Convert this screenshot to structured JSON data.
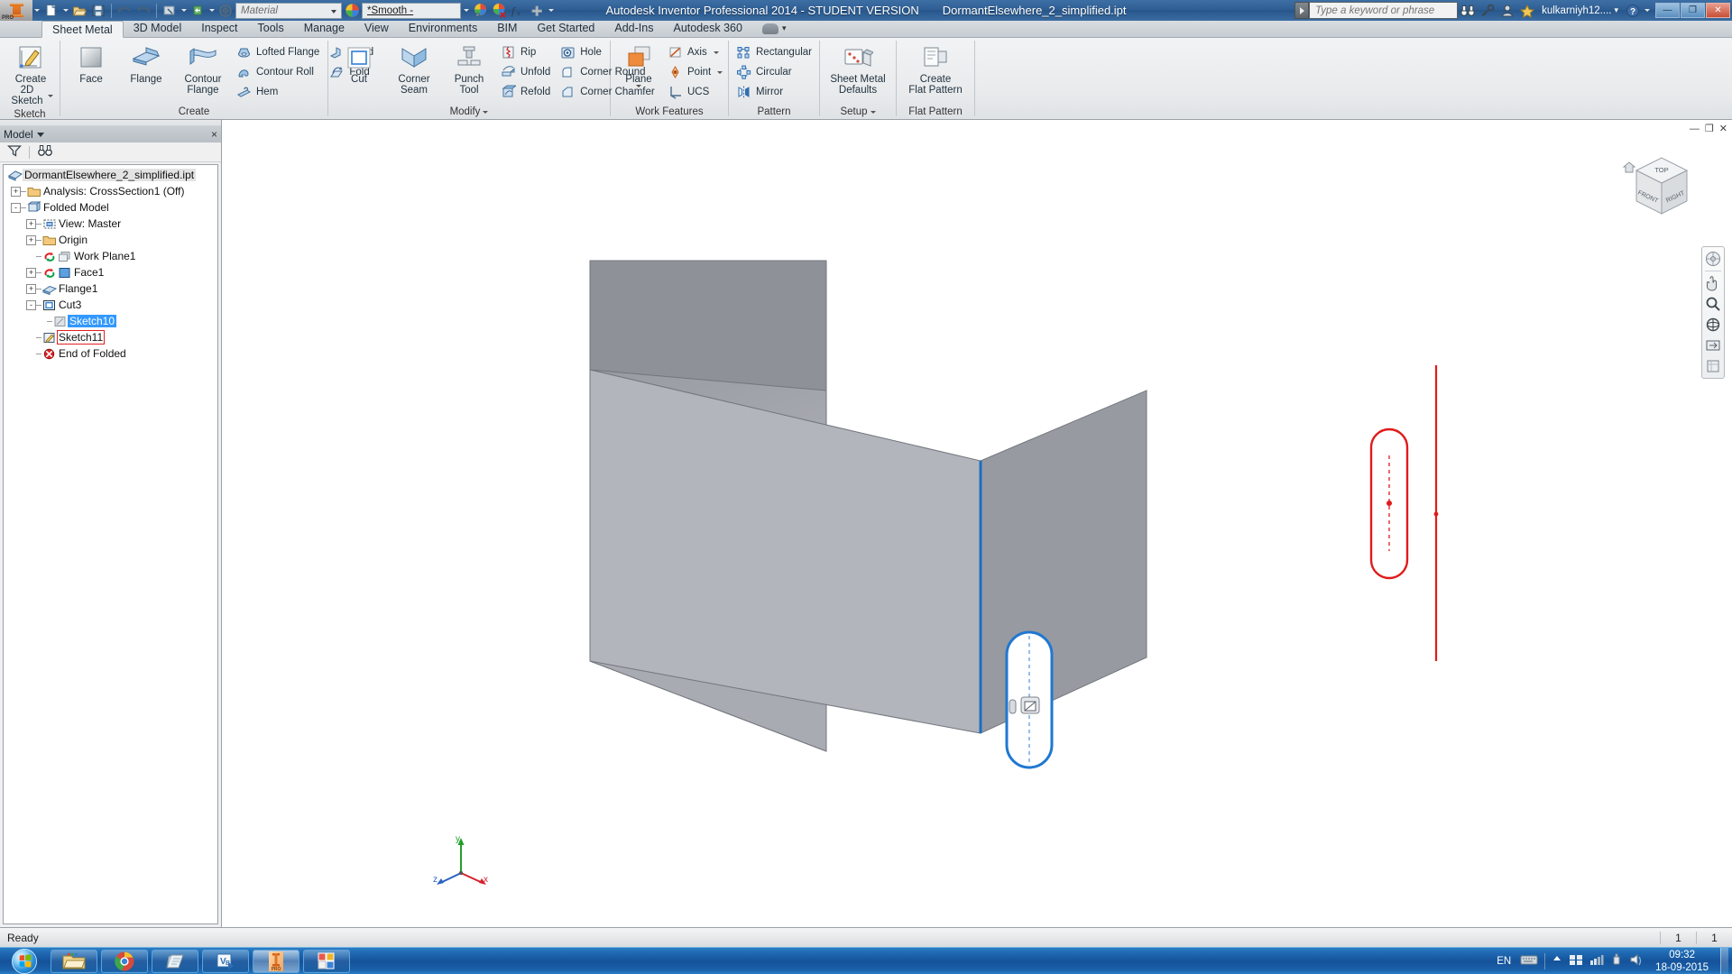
{
  "window": {
    "title": "Autodesk Inventor Professional 2014 - STUDENT VERSION",
    "filename": "DormantElsewhere_2_simplified.ipt",
    "minimize_label": "—",
    "maximize_label": "❐",
    "close_label": "✕"
  },
  "quick_access": {
    "material_value": "Material",
    "appearance_value": "*Smooth -",
    "buttons": [
      {
        "name": "new-document",
        "tip": "New"
      },
      {
        "name": "open-document",
        "tip": "Open"
      },
      {
        "name": "save-document",
        "tip": "Save"
      },
      {
        "name": "undo",
        "tip": "Undo"
      },
      {
        "name": "redo",
        "tip": "Redo"
      },
      {
        "name": "select",
        "tip": "Select"
      },
      {
        "name": "return",
        "tip": "Return"
      },
      {
        "name": "update",
        "tip": "Update"
      },
      {
        "name": "appearance",
        "tip": "Appearance"
      },
      {
        "name": "clear-appearance",
        "tip": "Clear Appearance"
      },
      {
        "name": "parameters",
        "tip": "fx Parameters"
      },
      {
        "name": "customize",
        "tip": "Customize"
      }
    ]
  },
  "infocenter": {
    "search_placeholder": "Type a keyword or phrase",
    "user": "kulkarniyh12....",
    "icons": [
      "binoculars-icon",
      "key-icon",
      "person-icon",
      "star-icon",
      "sign-in-icon",
      "help-icon"
    ]
  },
  "tabs": [
    {
      "label": "Sheet Metal",
      "active": true
    },
    {
      "label": "3D Model",
      "active": false
    },
    {
      "label": "Inspect",
      "active": false
    },
    {
      "label": "Tools",
      "active": false
    },
    {
      "label": "Manage",
      "active": false
    },
    {
      "label": "View",
      "active": false
    },
    {
      "label": "Environments",
      "active": false
    },
    {
      "label": "BIM",
      "active": false
    },
    {
      "label": "Get Started",
      "active": false
    },
    {
      "label": "Add-Ins",
      "active": false
    },
    {
      "label": "Autodesk 360",
      "active": false
    }
  ],
  "ribbon": {
    "panels": [
      {
        "title": "Sketch",
        "has_dropdown": false,
        "big": [
          {
            "label1": "Create",
            "label2": "2D Sketch",
            "icon": "create-2d-sketch-icon",
            "dropdown": true
          }
        ],
        "small_groups": []
      },
      {
        "title": "Create",
        "has_dropdown": false,
        "big": [
          {
            "label1": "Face",
            "label2": "",
            "icon": "face-icon",
            "dropdown": false
          },
          {
            "label1": "Flange",
            "label2": "",
            "icon": "flange-icon",
            "dropdown": false
          },
          {
            "label1": "Contour",
            "label2": "Flange",
            "icon": "contour-flange-icon",
            "dropdown": false
          }
        ],
        "small_groups": [
          [
            {
              "label": "Lofted Flange",
              "icon": "lofted-flange-icon"
            },
            {
              "label": "Contour Roll",
              "icon": "contour-roll-icon"
            },
            {
              "label": "Hem",
              "icon": "hem-icon"
            }
          ],
          [
            {
              "label": "Bend",
              "icon": "bend-icon"
            },
            {
              "label": "Fold",
              "icon": "fold-icon"
            }
          ]
        ]
      },
      {
        "title": "Modify",
        "has_dropdown": true,
        "big": [
          {
            "label1": "Cut",
            "label2": "",
            "icon": "cut-icon",
            "dropdown": false
          },
          {
            "label1": "Corner",
            "label2": "Seam",
            "icon": "corner-seam-icon",
            "dropdown": false
          },
          {
            "label1": "Punch",
            "label2": "Tool",
            "icon": "punch-tool-icon",
            "dropdown": false
          }
        ],
        "small_groups": [
          [
            {
              "label": "Rip",
              "icon": "rip-icon"
            },
            {
              "label": "Unfold",
              "icon": "unfold-icon"
            },
            {
              "label": "Refold",
              "icon": "refold-icon"
            }
          ],
          [
            {
              "label": "Hole",
              "icon": "hole-icon"
            },
            {
              "label": "Corner Round",
              "icon": "corner-round-icon"
            },
            {
              "label": "Corner Chamfer",
              "icon": "corner-chamfer-icon"
            }
          ]
        ]
      },
      {
        "title": "Work Features",
        "has_dropdown": false,
        "big": [
          {
            "label1": "Plane",
            "label2": "",
            "icon": "work-plane-icon",
            "dropdown": true
          }
        ],
        "small_groups": [
          [
            {
              "label": "Axis",
              "icon": "work-axis-icon",
              "dropdown": true
            },
            {
              "label": "Point",
              "icon": "work-point-icon",
              "dropdown": true
            },
            {
              "label": "UCS",
              "icon": "ucs-icon"
            }
          ]
        ]
      },
      {
        "title": "Pattern",
        "has_dropdown": false,
        "big": [],
        "small_groups": [
          [
            {
              "label": "Rectangular",
              "icon": "rectangular-pattern-icon"
            },
            {
              "label": "Circular",
              "icon": "circular-pattern-icon"
            },
            {
              "label": "Mirror",
              "icon": "mirror-icon"
            }
          ]
        ]
      },
      {
        "title": "Setup",
        "has_dropdown": true,
        "big": [
          {
            "label1": "Sheet Metal",
            "label2": "Defaults",
            "icon": "sheet-metal-defaults-icon",
            "dropdown": false
          }
        ],
        "small_groups": []
      },
      {
        "title": "Flat Pattern",
        "has_dropdown": false,
        "big": [
          {
            "label1": "Create",
            "label2": "Flat Pattern",
            "icon": "create-flat-pattern-icon",
            "dropdown": false
          }
        ],
        "small_groups": []
      }
    ]
  },
  "browser": {
    "header_label": "Model",
    "close_label": "×",
    "filter_icon": "filter-icon",
    "find_icon": "binoculars-icon",
    "tree": [
      {
        "label": "DormantElsewhere_2_simplified.ipt",
        "depth": 0,
        "expander": "",
        "icon": "part-file-icon",
        "state": "file"
      },
      {
        "label": "Analysis: CrossSection1 (Off)",
        "depth": 1,
        "expander": "+",
        "icon": "folder-icon",
        "state": "normal"
      },
      {
        "label": "Folded Model",
        "depth": 1,
        "expander": "-",
        "icon": "folded-model-icon",
        "state": "normal"
      },
      {
        "label": "View: Master",
        "depth": 2,
        "expander": "+",
        "icon": "view-master-icon",
        "state": "normal"
      },
      {
        "label": "Origin",
        "depth": 2,
        "expander": "+",
        "icon": "folder-icon",
        "state": "normal"
      },
      {
        "label": "Work Plane1",
        "depth": 2,
        "expander": "",
        "icon": "work-plane-tree-icon",
        "state": "normal"
      },
      {
        "label": "Face1",
        "depth": 2,
        "expander": "+",
        "icon": "face-tree-icon",
        "state": "normal"
      },
      {
        "label": "Flange1",
        "depth": 2,
        "expander": "+",
        "icon": "flange-tree-icon",
        "state": "normal"
      },
      {
        "label": "Cut3",
        "depth": 2,
        "expander": "-",
        "icon": "cut-tree-icon",
        "state": "normal"
      },
      {
        "label": "Sketch10",
        "depth": 3,
        "expander": "",
        "icon": "sketch-consumed-icon",
        "state": "selected"
      },
      {
        "label": "Sketch11",
        "depth": 2,
        "expander": "",
        "icon": "sketch-active-icon",
        "state": "edit"
      },
      {
        "label": "End of Folded",
        "depth": 2,
        "expander": "",
        "icon": "end-of-part-icon",
        "state": "normal"
      }
    ]
  },
  "viewport": {
    "minimize_label": "—",
    "restore_label": "❐",
    "close_label": "✕",
    "viewcube": {
      "top": "TOP",
      "front": "FRONT",
      "right": "RIGHT",
      "home_icon": "home-icon"
    },
    "navbar_icons": [
      "full-navigation-wheel-icon",
      "pan-icon",
      "zoom-icon",
      "orbit-icon",
      "look-at-icon",
      "view-presets-icon"
    ],
    "axis_triad": {
      "x": "x",
      "y": "y",
      "z": "z"
    },
    "colors": {
      "face_light": "#b9bcc2",
      "face_mid": "#a3a6ad",
      "face_dark": "#8e9198",
      "sketch_red": "#e01b1b",
      "sketch_blue": "#2277dd",
      "edge_blue": "#1a6fc4"
    }
  },
  "statusbar": {
    "message": "Ready",
    "field1": "1",
    "field2": "1"
  },
  "taskbar": {
    "start_label": "Start",
    "items": [
      {
        "name": "windows-explorer",
        "active": false
      },
      {
        "name": "google-chrome",
        "active": false
      },
      {
        "name": "notepad",
        "active": false
      },
      {
        "name": "visual-basic",
        "active": false
      },
      {
        "name": "autodesk-inventor",
        "active": true
      },
      {
        "name": "microsoft-office",
        "active": false
      }
    ],
    "tray": {
      "language": "EN",
      "icons": [
        "keyboard-icon",
        "show-hidden-icon",
        "network-icon",
        "action-center-icon",
        "usb-icon",
        "volume-icon"
      ],
      "time": "09:32",
      "date": "18-09-2015"
    }
  }
}
